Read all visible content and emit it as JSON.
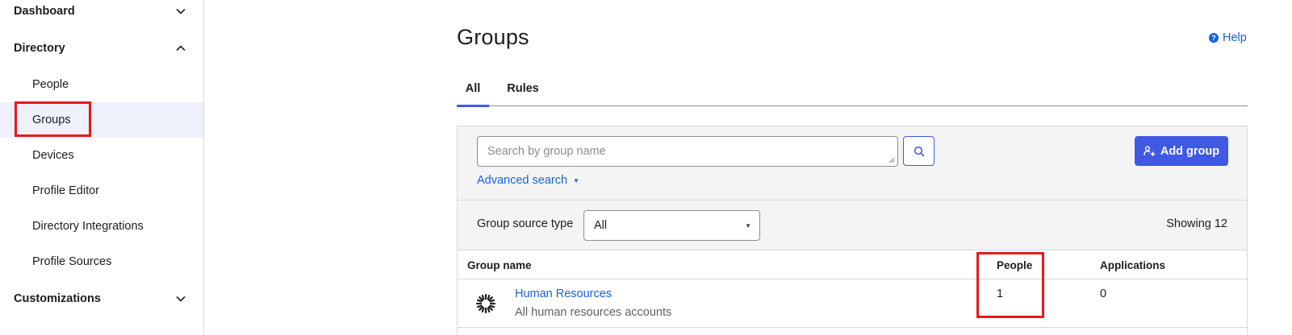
{
  "sidebar": {
    "sections": [
      {
        "label": "Dashboard",
        "expanded": false
      },
      {
        "label": "Directory",
        "expanded": true
      },
      {
        "label": "Customizations",
        "expanded": false
      }
    ],
    "directory_items": [
      {
        "label": "People"
      },
      {
        "label": "Groups",
        "active": true
      },
      {
        "label": "Devices"
      },
      {
        "label": "Profile Editor"
      },
      {
        "label": "Directory Integrations"
      },
      {
        "label": "Profile Sources"
      }
    ]
  },
  "header": {
    "title": "Groups",
    "help_label": "Help",
    "help_icon": "?"
  },
  "tabs": [
    {
      "label": "All",
      "active": true
    },
    {
      "label": "Rules",
      "active": false
    }
  ],
  "search": {
    "placeholder": "Search by group name",
    "value": "",
    "advanced_label": "Advanced search",
    "advanced_caret": "▼"
  },
  "toolbar": {
    "add_group_label": "Add group"
  },
  "filter": {
    "label": "Group source type",
    "selected": "All",
    "caret": "▼",
    "showing": "Showing 12"
  },
  "table": {
    "columns": [
      "Group name",
      "People",
      "Applications"
    ],
    "rows": [
      {
        "name": "Human Resources",
        "description": "All human resources accounts",
        "people": "1",
        "applications": "0"
      }
    ]
  },
  "colors": {
    "accent": "#3f59e4",
    "link": "#1662dd",
    "highlight": "#e5191d",
    "active_nav_bg": "#eef0fb"
  }
}
